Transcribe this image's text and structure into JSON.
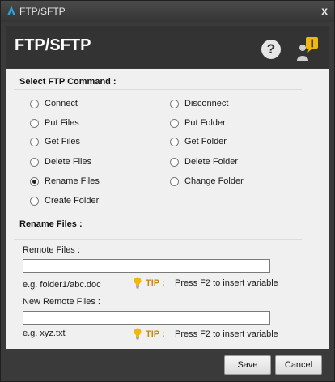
{
  "window": {
    "title": "FTP/SFTP",
    "close_glyph": "x"
  },
  "header": {
    "title": "FTP/SFTP",
    "help_glyph": "?"
  },
  "command_section": {
    "title": "Select FTP Command :"
  },
  "commands": [
    {
      "label": "Connect",
      "selected": false
    },
    {
      "label": "Disconnect",
      "selected": false
    },
    {
      "label": "Put Files",
      "selected": false
    },
    {
      "label": "Put Folder",
      "selected": false
    },
    {
      "label": "Get Files",
      "selected": false
    },
    {
      "label": "Get Folder",
      "selected": false
    },
    {
      "label": "Delete Files",
      "selected": false
    },
    {
      "label": "Delete Folder",
      "selected": false
    },
    {
      "label": "Rename Files",
      "selected": true
    },
    {
      "label": "Change Folder",
      "selected": false
    },
    {
      "label": "Create Folder",
      "selected": false
    }
  ],
  "rename_section": {
    "title": "Rename Files :",
    "remote_files": {
      "label": "Remote Files :",
      "value": "",
      "example": "e.g. folder1/abc.doc"
    },
    "new_remote_files": {
      "label": "New Remote Files :",
      "value": "",
      "example": "e.g. xyz.txt"
    },
    "tip": {
      "key": "TIP :",
      "text": "Press F2 to insert variable"
    }
  },
  "footer": {
    "save_label": "Save",
    "cancel_label": "Cancel"
  },
  "colors": {
    "tip_accent": "#c8860a",
    "notification_badge": "#f2b70f",
    "logo": "#2aa3e0"
  },
  "icons": {
    "logo": "app-logo-icon",
    "help": "help-icon",
    "user": "user-notification-icon",
    "tip": "lightbulb-icon",
    "close": "close-icon"
  }
}
